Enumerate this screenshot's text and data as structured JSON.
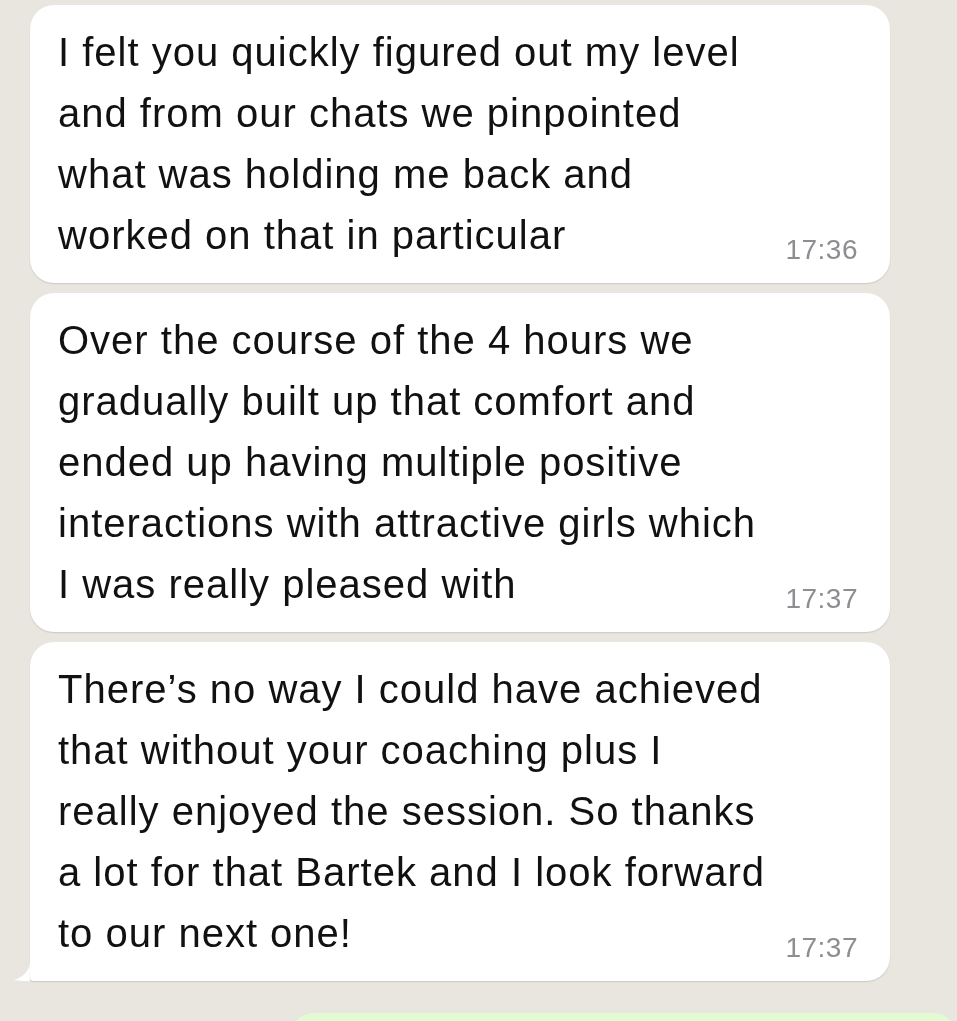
{
  "messages": [
    {
      "kind": "incoming",
      "text": "I felt you quickly figured out my level and from our chats we pinpointed what was holding me back and worked on that in particular",
      "time": "17:36",
      "tail": false
    },
    {
      "kind": "incoming",
      "text": "Over the course of the 4 hours we gradually built up that comfort and ended up having multiple positive interactions with attractive girls which I was really pleased with",
      "time": "17:37",
      "tail": false
    },
    {
      "kind": "incoming",
      "text": "There’s no way I could have achieved that without your coaching plus I really enjoyed the session. So thanks a lot for that Bartek and I look forward to our next one!",
      "time": "17:37",
      "tail": true
    },
    {
      "kind": "outgoing"
    }
  ]
}
